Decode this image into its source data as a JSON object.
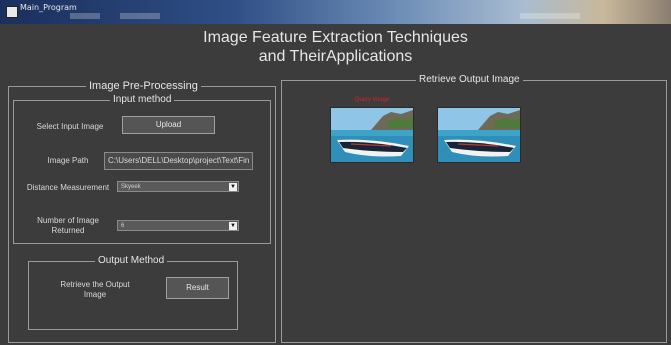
{
  "window": {
    "title": "Main_Program"
  },
  "header": {
    "line1": "Image Feature Extraction Techniques",
    "line2": "and TheirApplications"
  },
  "preprocessing": {
    "legend": "Image Pre-Processing",
    "input_method": {
      "legend": "Input method",
      "select_label": "Select Input Image",
      "upload_label": "Upload",
      "path_label": "Image Path",
      "path_value": "C:\\Users\\DELL\\Desktop\\project\\Text\\Fin",
      "distance_label": "Distance Measurement",
      "distance_value": "Skyeek",
      "count_label": "Number of Image Returned",
      "count_value": "6"
    },
    "output_method": {
      "legend": "Output Method",
      "retrieve_label": "Retrieve the Output Image",
      "result_label": "Result"
    }
  },
  "output_panel": {
    "legend": "Retrieve Output Image",
    "images": [
      {
        "caption": "Query Image"
      },
      {
        "caption": ""
      }
    ]
  },
  "colors": {
    "background": "#3c3c3c",
    "border": "#9a9a9a",
    "text": "#e6e6e6",
    "caption": "#e02020"
  }
}
